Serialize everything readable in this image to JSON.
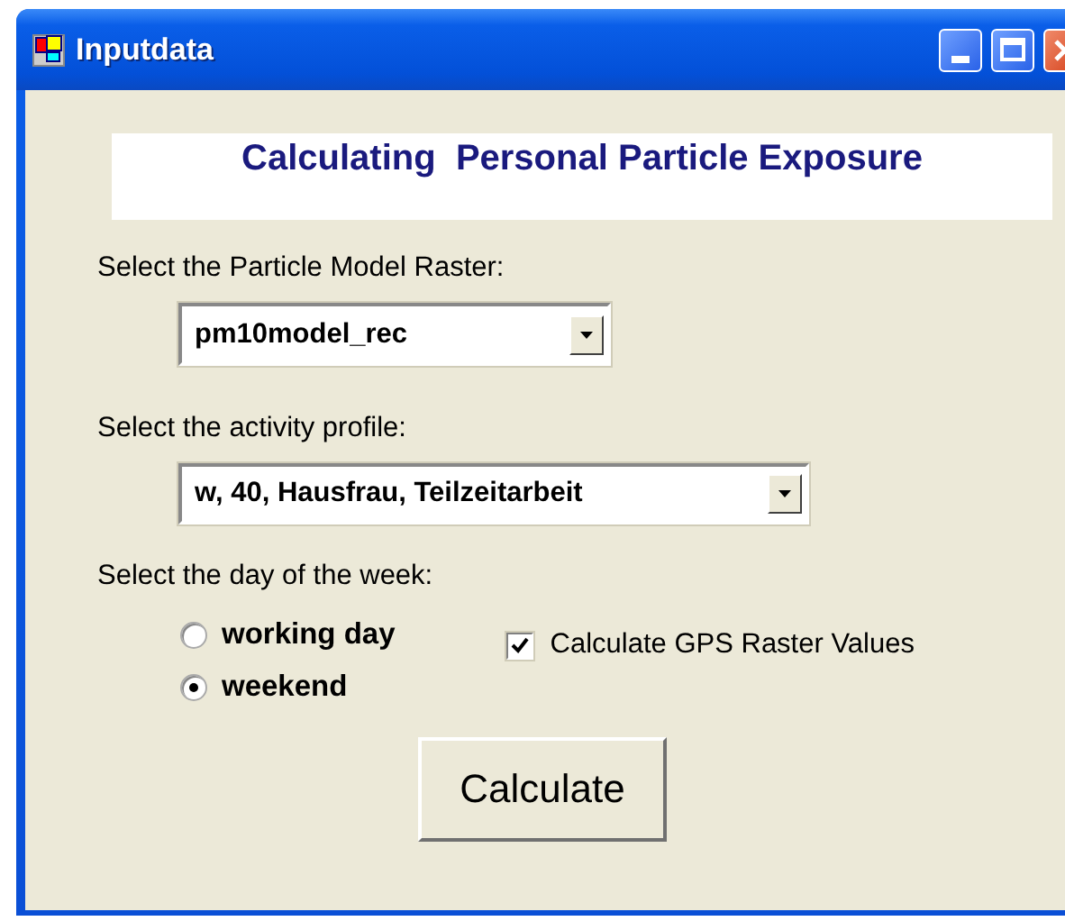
{
  "window": {
    "title": "Inputdata"
  },
  "header": "Calculating  Personal Particle Exposure",
  "raster": {
    "label": "Select the Particle Model Raster:",
    "value": "pm10model_rec"
  },
  "profile": {
    "label": "Select the activity profile:",
    "value": "w, 40, Hausfrau, Teilzeitarbeit"
  },
  "day": {
    "label": "Select the day of the week:",
    "options": [
      {
        "label": "working day",
        "selected": false
      },
      {
        "label": "weekend",
        "selected": true
      }
    ]
  },
  "gps": {
    "label": "Calculate GPS Raster Values",
    "checked": true
  },
  "button": "Calculate"
}
